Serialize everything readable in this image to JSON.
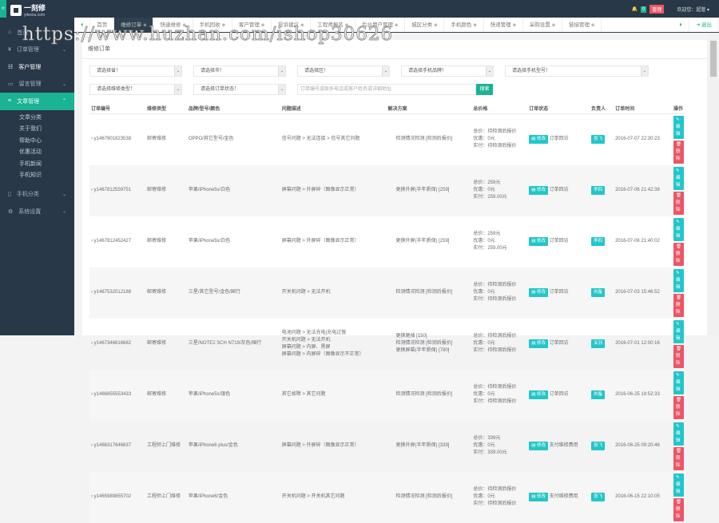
{
  "header": {
    "collapse_icon": "«",
    "logo_title": "一刻修",
    "logo_sub": "yikexiu.com",
    "bell_count": "0",
    "badge": "管理",
    "user": "欢迎您：超管 ▾"
  },
  "sidebar": {
    "items": [
      {
        "label": "首页",
        "icon": "⌂"
      },
      {
        "label": "订单管理",
        "icon": "¥",
        "chev": "⌄"
      },
      {
        "label": "客户管理",
        "icon": "☷"
      },
      {
        "label": "留言管理",
        "icon": "▭",
        "chev": "⌄"
      },
      {
        "label": "文章管理",
        "icon": "≡",
        "chev": "⌃"
      }
    ],
    "sub": [
      "文章分类",
      "关于我们",
      "帮助中心",
      "优惠活动",
      "手机新闻",
      "手机知识"
    ],
    "items2": [
      {
        "label": "手机分类",
        "icon": "▯",
        "chev": "⌄"
      },
      {
        "label": "系统设置",
        "icon": "⚙",
        "chev": "⌄"
      }
    ]
  },
  "tabs": [
    "首页",
    "维修订单",
    "快速维修",
    "手机回收",
    "客户管理",
    "投诉建议",
    "工程师报名",
    "后台用户管理",
    "城区分类",
    "手机颜色",
    "快递管理",
    "采购设置",
    "链接管理"
  ],
  "tabs_right": {
    "next": "⏵",
    "logout": "退出"
  },
  "watermark": "https://www.huzhan.com/ishop30626",
  "panel_title": "维修订单",
  "filters": {
    "province": "请选择省！",
    "city": "请选择市！",
    "district": "请选择区！",
    "brand": "请选择手机品牌！",
    "model": "请选择手机型号！",
    "repair_type": "请选择维修类型！",
    "status": "请选择订单状态！",
    "search_placeholder": "订单编号或联系电话或客户姓名或详细地址",
    "search": "搜索"
  },
  "table": {
    "headers": [
      "订单编号",
      "维修类型",
      "品牌/型号/颜色",
      "问题描述",
      "解决方案",
      "总价格",
      "订单状态",
      "负责人",
      "订单时间",
      "操作"
    ],
    "edit": "修改",
    "btn_edit": "编辑",
    "btn_delete": "删除",
    "rows": [
      {
        "id": "y1467901823538",
        "type": "邮寄维修",
        "device": "OPPO/其它型号/金色",
        "problems": [
          "信号问题 > 无法连接 > 信号其它问题"
        ],
        "solutions": [
          "检测情况检测 [检测后报价]"
        ],
        "price": [
          "总价：待检测后报价",
          "优惠：0元",
          "实付：待检测后报价"
        ],
        "status": "订单回访",
        "owner": "张飞",
        "time": "2016-07-07 22:30:23"
      },
      {
        "id": "y1467812559751",
        "type": "邮寄维修",
        "device": "苹果/iPhone5s/白色",
        "problems": [
          "屏幕问题 > 外屏碎（图像显示正常）"
        ],
        "solutions": [
          "更换外屏(半年质保) [259]"
        ],
        "price": [
          "总价：259元",
          "优惠：0元",
          "实付：259.00元"
        ],
        "status": "订单回访",
        "owner": "李四",
        "time": "2016-07-06 21:42:38"
      },
      {
        "id": "y1467812452427",
        "type": "邮寄维修",
        "device": "苹果/iPhone5s/白色",
        "problems": [
          "屏幕问题 > 外屏碎（图像显示正常）"
        ],
        "solutions": [
          "更换外屏(半年质保) [259]"
        ],
        "price": [
          "总价：259元",
          "优惠：0元",
          "实付：259.00元"
        ],
        "status": "订单回访",
        "owner": "李四",
        "time": "2016-07-06 21:40:02"
      },
      {
        "id": "y1467532012188",
        "type": "邮寄维修",
        "device": "三星/其它型号/金色/国行",
        "problems": [
          "开关机问题 > 无法开机"
        ],
        "solutions": [
          "检测情况检测 [检测后报价]"
        ],
        "price": [
          "总价：待检测后报价",
          "优惠：0元",
          "实付：待检测后报价"
        ],
        "status": "订单回访",
        "owner": "刘备",
        "time": "2016-07-03 15:46:52"
      },
      {
        "id": "y1467346616682",
        "type": "邮寄维修",
        "device": "三星/NOTE2 SCH N719/灰色/国行",
        "problems": [
          "电池问题 > 无法充电|充电过慢",
          "开关机问题 > 无法开机",
          "屏幕问题 > 内屏、黑屏",
          "屏幕问题 > 内屏碎（图像显示不正常）"
        ],
        "solutions": [
          "更换尾插 [150]",
          "检测情况检测 [检测后报价]",
          "更换屏幕(半年质保) [780]"
        ],
        "price": [
          "总价：待检测后报价",
          "优惠：0元",
          "实付：待检测后报价"
        ],
        "status": "订单回访",
        "owner": "关羽",
        "time": "2016-07-01 12:00:16"
      },
      {
        "id": "y1466855553433",
        "type": "邮寄维修",
        "device": "苹果/iPhone5s/银色",
        "problems": [
          "其它故障 > 其它问题"
        ],
        "solutions": [
          "检测情况检测 [检测后报价]"
        ],
        "price": [
          "总价：待检测后报价",
          "优惠：0元",
          "实付：待检测后报价"
        ],
        "status": "订单回访",
        "owner": "刘备",
        "time": "2016-06-25 19:52:33"
      },
      {
        "id": "y1466317646637",
        "type": "工程师上门维修",
        "device": "苹果/iPhone6 plus/金色",
        "problems": [
          "屏幕问题 > 外屏碎（图像显示正常）"
        ],
        "solutions": [
          "更换外屏(半年质保) [339]"
        ],
        "price": [
          "总价：339元",
          "优惠：0元",
          "实付：339.00元"
        ],
        "status": "支付维修费用",
        "owner": "张飞",
        "time": "2016-06-25 09:20:46"
      },
      {
        "id": "y1465989855702",
        "type": "工程师上门维修",
        "device": "苹果/iPhone6/金色",
        "problems": [
          "开关机问题 > 开关机其它问题"
        ],
        "solutions": [
          "检测情况检测 [检测后报价]"
        ],
        "price": [
          "总价：待检测后报价",
          "优惠：0元",
          "实付：待检测后报价"
        ],
        "status": "支付维修费用",
        "owner": "张飞",
        "time": "2016-06-15 22:10:05"
      }
    ]
  }
}
